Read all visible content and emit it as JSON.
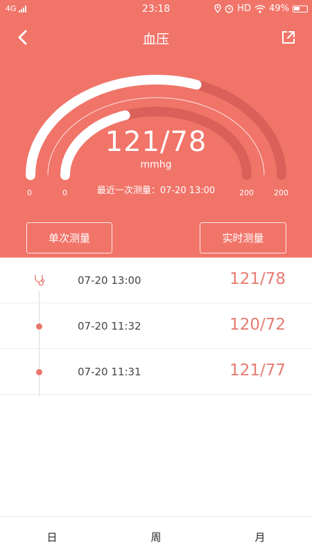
{
  "status_bar": {
    "network": "4G",
    "time": "23:18",
    "hd": "HD",
    "battery": "49%"
  },
  "header": {
    "title": "血压"
  },
  "gauge": {
    "value": "121/78",
    "unit": "mmhg",
    "last_measure": "最近一次测量：07-20 13:00",
    "outer_min": "0",
    "inner_min": "0",
    "inner_max": "200",
    "outer_max": "200",
    "systolic": 121,
    "diastolic": 78,
    "scale_max": 200
  },
  "buttons": {
    "single": "单次测量",
    "realtime": "实时测量"
  },
  "records": [
    {
      "time": "07-20 13:00",
      "value": "121/78"
    },
    {
      "time": "07-20 11:32",
      "value": "120/72"
    },
    {
      "time": "07-20 11:31",
      "value": "121/77"
    }
  ],
  "tabs": {
    "day": "日",
    "week": "周",
    "month": "月"
  },
  "colors": {
    "primary": "#f17469",
    "value_text": "#e67b70"
  }
}
